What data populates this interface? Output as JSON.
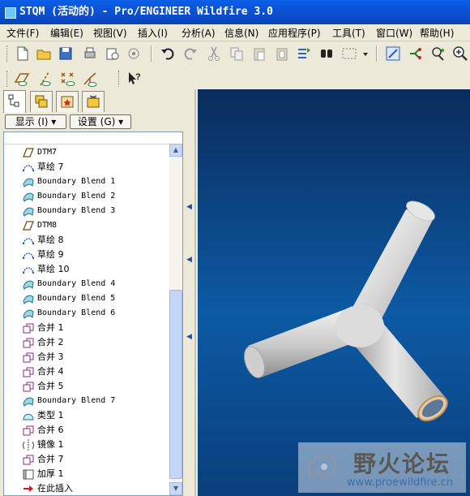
{
  "window": {
    "title": "STQM (活动的) - Pro/ENGINEER Wildfire 3.0"
  },
  "menu": [
    "文件(F)",
    "编辑(E)",
    "视图(V)",
    "插入(I)",
    "分析(A)",
    "信息(N)",
    "应用程序(P)",
    "工具(T)",
    "窗口(W)",
    "帮助(H)"
  ],
  "toolbar1": [
    "new-file-icon",
    "open-folder-icon",
    "save-icon",
    "print-icon",
    "email-icon",
    "link-icon",
    "undo-icon",
    "redo-icon",
    "cut-icon",
    "copy-icon",
    "paste-icon",
    "paste-special-icon",
    "regenerate-icon",
    "find-icon",
    "select-box-icon",
    "dropdown-arrow-icon",
    "view-refit-icon",
    "relations-icon",
    "parameters-icon",
    "zoom-in-icon"
  ],
  "toolbar2": [
    "datum-plane-display-icon",
    "datum-axis-display-icon",
    "datum-point-display-icon",
    "coordinate-system-display-icon",
    "context-help-icon"
  ],
  "panel": {
    "tabs": [
      "model-tree-tab",
      "layer-tree-tab",
      "favorites-tab",
      "browser-tab"
    ],
    "show_label": "显示 (I) ▾",
    "settings_label": "设置 (G) ▾"
  },
  "tree": [
    {
      "icon": "datum-plane-icon",
      "label": "DTM7",
      "mono": true
    },
    {
      "icon": "sketch-icon",
      "label": "草绘 7",
      "mono": false
    },
    {
      "icon": "boundary-blend-icon",
      "label": "Boundary Blend 1",
      "mono": true
    },
    {
      "icon": "boundary-blend-icon",
      "label": "Boundary Blend 2",
      "mono": true
    },
    {
      "icon": "boundary-blend-icon",
      "label": "Boundary Blend 3",
      "mono": true
    },
    {
      "icon": "datum-plane-icon",
      "label": "DTM8",
      "mono": true
    },
    {
      "icon": "sketch-icon",
      "label": "草绘 8",
      "mono": false
    },
    {
      "icon": "sketch-icon",
      "label": "草绘 9",
      "mono": false
    },
    {
      "icon": "sketch-icon",
      "label": "草绘 10",
      "mono": false
    },
    {
      "icon": "boundary-blend-icon",
      "label": "Boundary Blend 4",
      "mono": true
    },
    {
      "icon": "boundary-blend-icon",
      "label": "Boundary Blend 5",
      "mono": true
    },
    {
      "icon": "boundary-blend-icon",
      "label": "Boundary Blend 6",
      "mono": true
    },
    {
      "icon": "merge-icon",
      "label": "合并 1",
      "mono": false
    },
    {
      "icon": "merge-icon",
      "label": "合并 2",
      "mono": false
    },
    {
      "icon": "merge-icon",
      "label": "合并 3",
      "mono": false
    },
    {
      "icon": "merge-icon",
      "label": "合并 4",
      "mono": false
    },
    {
      "icon": "merge-icon",
      "label": "合并 5",
      "mono": false
    },
    {
      "icon": "boundary-blend-icon",
      "label": "Boundary Blend 7",
      "mono": true
    },
    {
      "icon": "type-icon",
      "label": "类型 1",
      "mono": false
    },
    {
      "icon": "merge-icon",
      "label": "合并 6",
      "mono": false
    },
    {
      "icon": "mirror-icon",
      "label": "镜像 1",
      "mono": false
    },
    {
      "icon": "merge-icon",
      "label": "合并 7",
      "mono": false
    },
    {
      "icon": "thicken-icon",
      "label": "加厚 1",
      "mono": false
    },
    {
      "icon": "insert-here-arrow-icon",
      "label": "在此插入",
      "mono": false
    }
  ],
  "watermark": {
    "title": "野火论坛",
    "url": "www.proewildfire.cn"
  }
}
